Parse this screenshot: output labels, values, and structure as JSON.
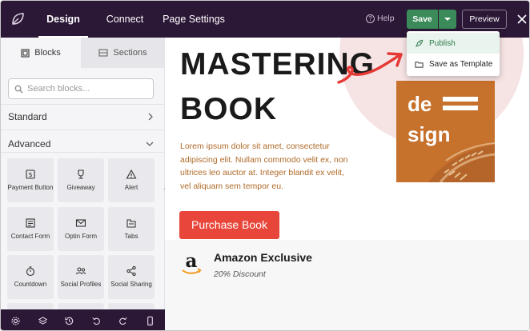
{
  "topbar": {
    "tabs": [
      {
        "label": "Design",
        "active": true
      },
      {
        "label": "Connect",
        "active": false
      },
      {
        "label": "Page Settings",
        "active": false
      }
    ],
    "help_label": "Help",
    "save_label": "Save",
    "preview_label": "Preview"
  },
  "save_menu": {
    "items": [
      {
        "label": "Publish",
        "icon": "rocket-icon"
      },
      {
        "label": "Save as Template",
        "icon": "folder-icon"
      }
    ]
  },
  "sidebar": {
    "tabs": [
      {
        "label": "Blocks",
        "active": true,
        "icon": "blocks-icon"
      },
      {
        "label": "Sections",
        "active": false,
        "icon": "sections-icon"
      }
    ],
    "search_placeholder": "Search blocks...",
    "standard_label": "Standard",
    "advanced_label": "Advanced",
    "blocks": [
      {
        "label": "Payment Button",
        "icon": "dollar-icon"
      },
      {
        "label": "Giveaway",
        "icon": "trophy-icon"
      },
      {
        "label": "Alert",
        "icon": "alert-icon"
      },
      {
        "label": "Contact Form",
        "icon": "form-icon"
      },
      {
        "label": "Optin Form",
        "icon": "envelope-icon"
      },
      {
        "label": "Tabs",
        "icon": "tabs-icon"
      },
      {
        "label": "Countdown",
        "icon": "stopwatch-icon"
      },
      {
        "label": "Social Profiles",
        "icon": "users-icon"
      },
      {
        "label": "Social Sharing",
        "icon": "share-icon"
      }
    ]
  },
  "bottombar": {
    "icons": [
      "gear-icon",
      "layers-icon",
      "history-icon",
      "undo-icon",
      "redo-icon",
      "mobile-icon"
    ]
  },
  "canvas": {
    "headline_line1": "MASTERING",
    "headline_line2": "BOOK",
    "description": "Lorem ipsum dolor sit amet, consectetur adipiscing elit. Nullam commodo velit ex, non ultrices leo auctor at. Integer blandit ex velit, vel aliquam sem tempor eu.",
    "purchase_label": "Purchase Book",
    "book_cover_line1": "de",
    "book_cover_line2": "sign",
    "amazon_title": "Amazon Exclusive",
    "amazon_subtitle": "20% Discount"
  },
  "colors": {
    "topbar_bg": "#2b1736",
    "save_green": "#3a8a5a",
    "purchase_red": "#e8463a",
    "lorem_text": "#b06a28",
    "book_orange": "#c6712c",
    "arrow_red": "#e53935"
  }
}
